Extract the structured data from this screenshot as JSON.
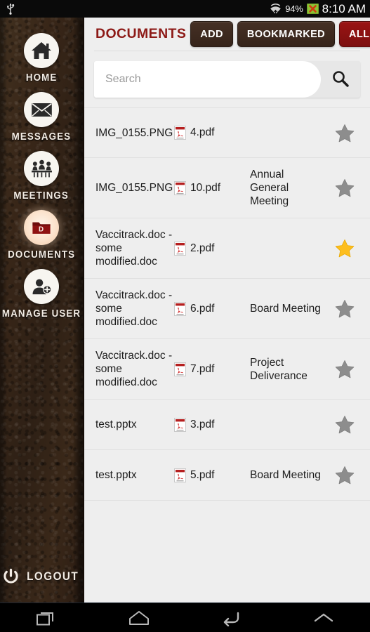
{
  "statusbar": {
    "usb_icon": "usb-icon",
    "wifi_icon": "wifi-icon",
    "battery_percent": "94%",
    "battery_icon": "battery-error-icon",
    "clock": "8:10 AM"
  },
  "sidebar": {
    "items": [
      {
        "label": "HOME",
        "icon": "home-icon",
        "active": false
      },
      {
        "label": "MESSAGES",
        "icon": "envelope-icon",
        "active": false
      },
      {
        "label": "MEETINGS",
        "icon": "meeting-people-icon",
        "active": false
      },
      {
        "label": "DOCUMENTS",
        "icon": "folder-d-icon",
        "active": true
      },
      {
        "label": "MANAGE USER",
        "icon": "user-add-icon",
        "active": false
      }
    ],
    "logout": {
      "label": "LOGOUT",
      "icon": "power-icon"
    }
  },
  "header": {
    "title": "DOCUMENTS",
    "buttons": [
      {
        "label": "ADD",
        "style": "brown"
      },
      {
        "label": "BOOKMARKED",
        "style": "brown"
      },
      {
        "label": "ALL",
        "style": "red"
      }
    ]
  },
  "search": {
    "placeholder": "Search",
    "value": "",
    "icon": "search-icon"
  },
  "documents": {
    "rows": [
      {
        "file": "IMG_0155.PNG",
        "pdf": "4.pdf",
        "meeting": "",
        "bookmarked": false
      },
      {
        "file": "IMG_0155.PNG",
        "pdf": "10.pdf",
        "meeting": "Annual General Meeting",
        "bookmarked": false
      },
      {
        "file": "Vaccitrack.doc -some modified.doc",
        "pdf": "2.pdf",
        "meeting": "",
        "bookmarked": true
      },
      {
        "file": "Vaccitrack.doc -some modified.doc",
        "pdf": "6.pdf",
        "meeting": "Board Meeting",
        "bookmarked": false
      },
      {
        "file": "Vaccitrack.doc -some modified.doc",
        "pdf": "7.pdf",
        "meeting": "Project Deliverance",
        "bookmarked": false
      },
      {
        "file": "test.pptx",
        "pdf": "3.pdf",
        "meeting": "",
        "bookmarked": false
      },
      {
        "file": "test.pptx",
        "pdf": "5.pdf",
        "meeting": "Board Meeting",
        "bookmarked": false
      }
    ]
  },
  "navbar": {
    "buttons": [
      {
        "name": "recent-apps",
        "icon": "recent-apps-icon"
      },
      {
        "name": "home",
        "icon": "home-outline-icon"
      },
      {
        "name": "back",
        "icon": "back-arrow-icon"
      },
      {
        "name": "hide-keyboard",
        "icon": "chevron-up-icon"
      }
    ]
  },
  "colors": {
    "accent_red": "#8d1a17",
    "button_red": "#8b1212",
    "button_brown": "#3e2b22",
    "star_active": "#fdbe1e",
    "star_inactive": "#8d8d8d",
    "leather_brown": "#35241a"
  }
}
